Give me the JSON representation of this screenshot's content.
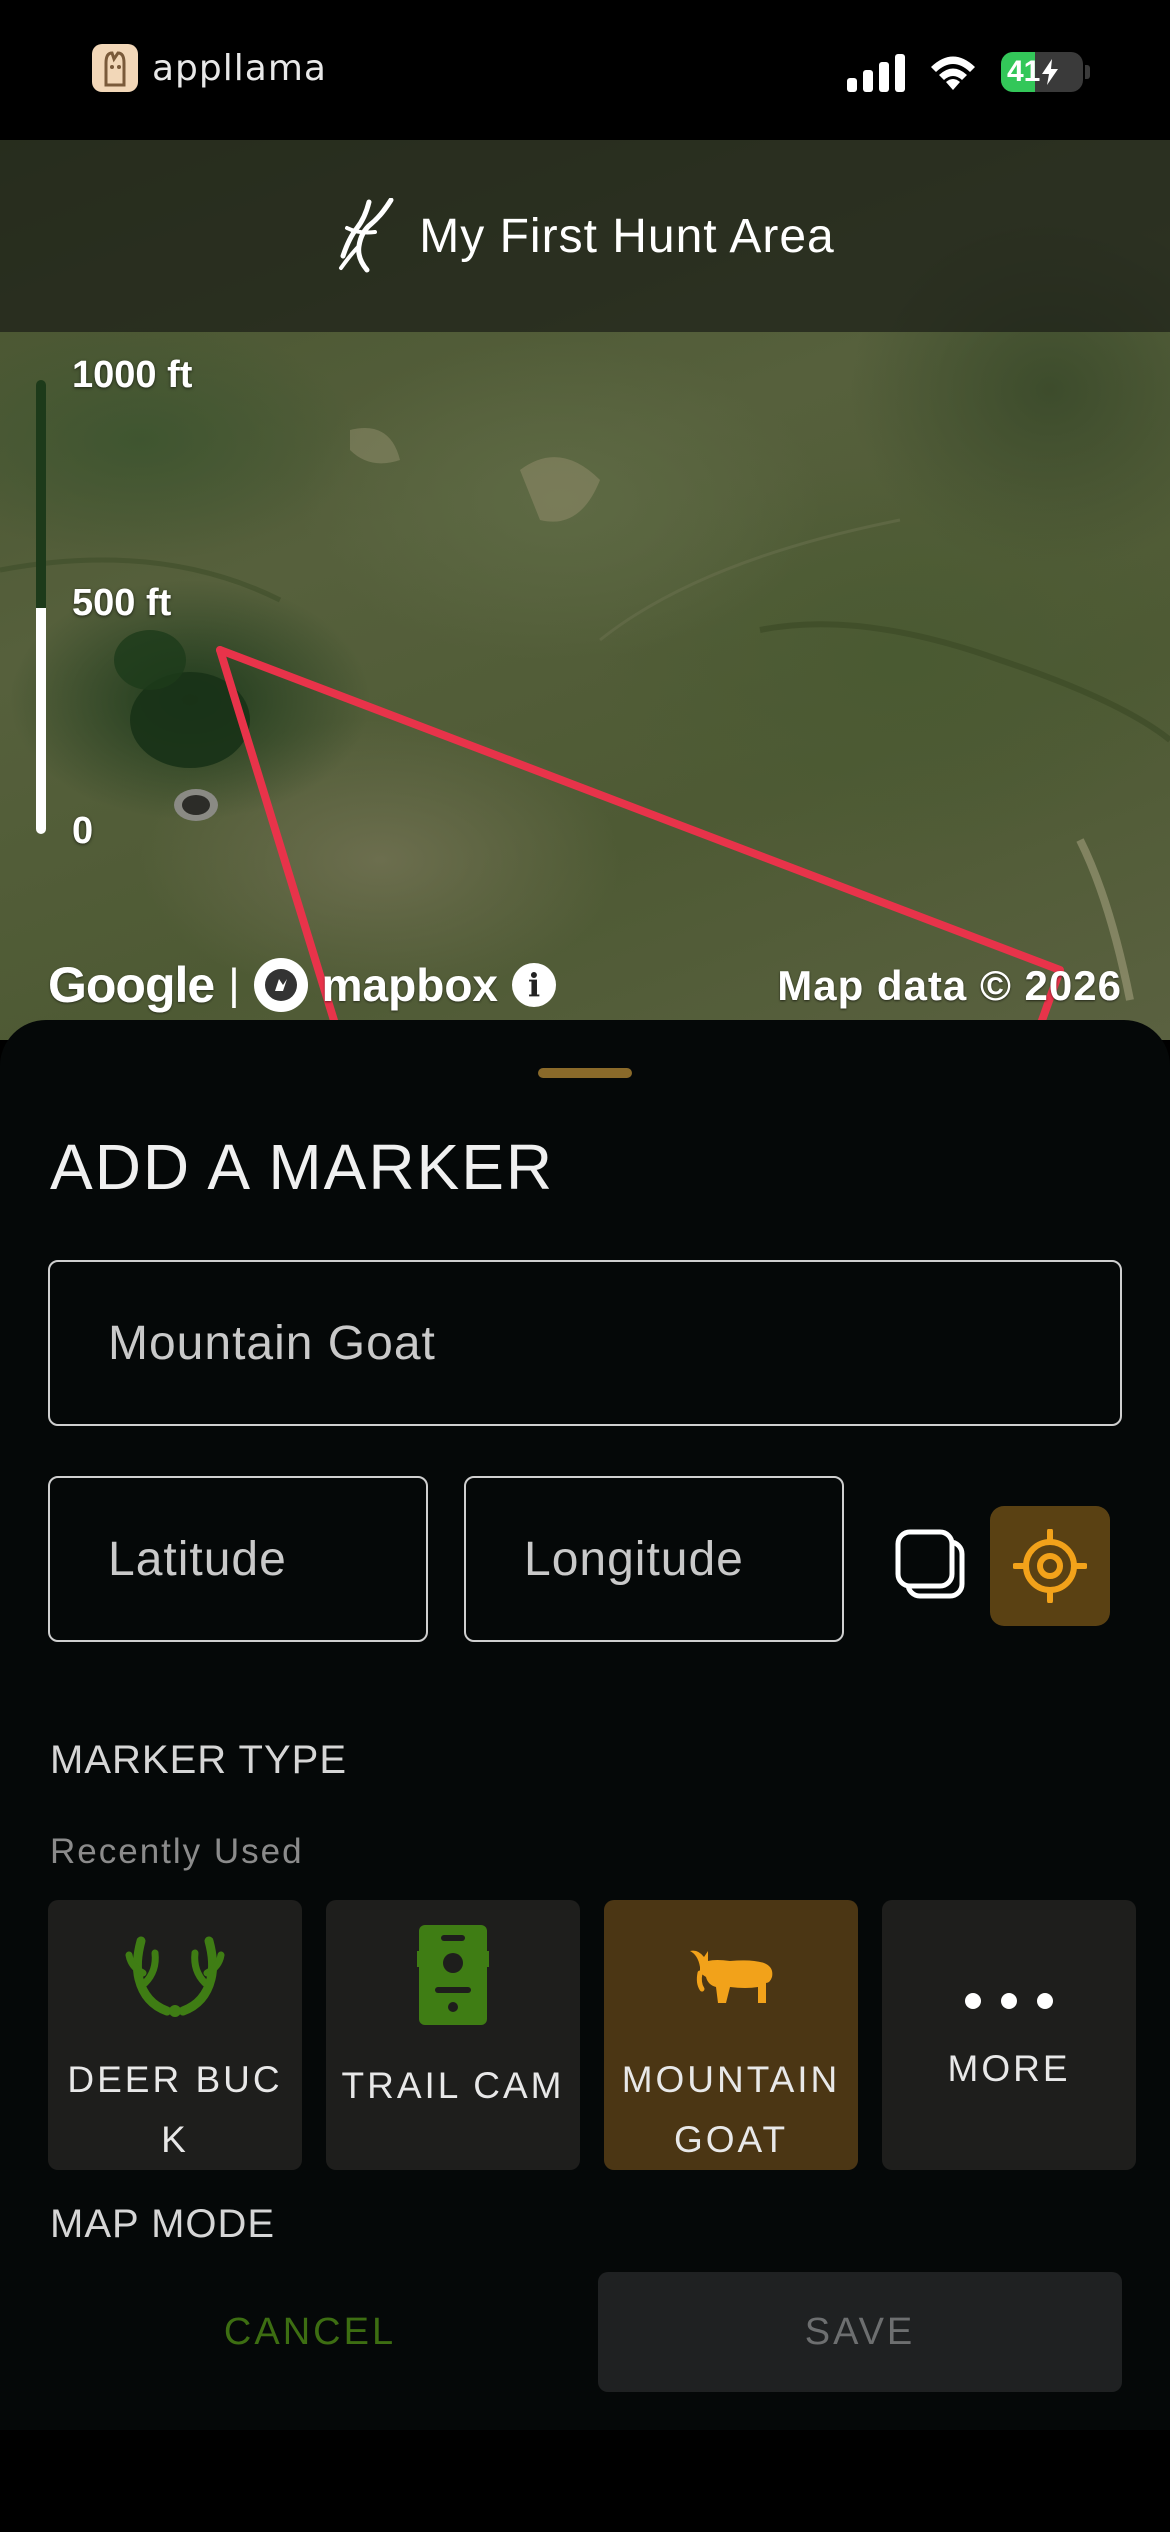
{
  "status_bar": {
    "carrier": "appllama",
    "battery": "41",
    "battery_charging": true
  },
  "map": {
    "title": "My First Hunt Area",
    "scale_labels": [
      "1000 ft",
      "500 ft",
      "0"
    ],
    "attribution": {
      "google": "Google",
      "separator": "|",
      "mapbox": "mapbox",
      "info": "i",
      "data": "Map data © 2026"
    },
    "boundary_color": "#e8334a"
  },
  "sheet": {
    "title": "ADD A MARKER",
    "name_value": "Mountain Goat",
    "latitude_placeholder": "Latitude",
    "longitude_placeholder": "Longitude",
    "marker_type_label": "MARKER TYPE",
    "recently_used_label": "Recently Used",
    "tiles": [
      {
        "label": "DEER BUCK",
        "icon": "antlers-icon",
        "color": "#3f7d14",
        "selected": false
      },
      {
        "label": "TRAIL CAM",
        "icon": "trail-camera-icon",
        "color": "#3f7d14",
        "selected": false
      },
      {
        "label": "MOUNTAIN GOAT",
        "icon": "mountain-goat-icon",
        "color": "#f2a21a",
        "selected": true
      },
      {
        "label": "MORE",
        "icon": "ellipsis-icon",
        "color": "#ffffff",
        "selected": false
      }
    ],
    "map_mode_label": "MAP MODE",
    "cancel_label": "CANCEL",
    "save_label": "SAVE"
  },
  "colors": {
    "accent_gold": "#5a4113",
    "accent_green": "#3d6e12",
    "sheet_bg": "#050808"
  }
}
